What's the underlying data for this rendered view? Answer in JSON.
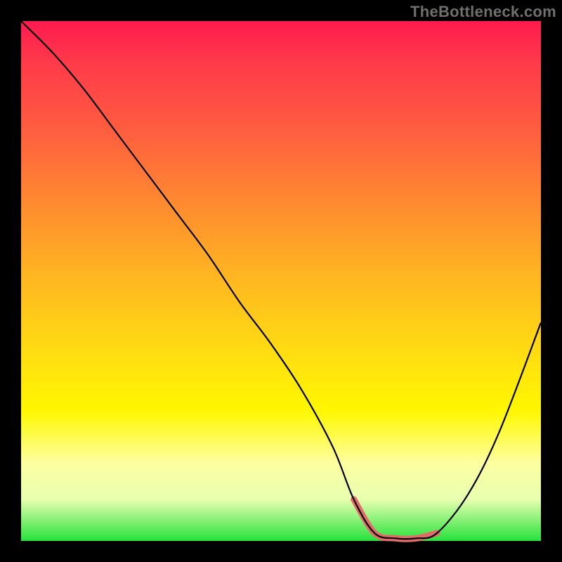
{
  "attribution": "TheBottleneck.com",
  "colors": {
    "gradient_top": "#ff1a4f",
    "gradient_bottom": "#26e23c",
    "curve": "#000000",
    "valley_highlight": "#e56b6b",
    "frame": "#000000"
  },
  "chart_data": {
    "type": "line",
    "title": "",
    "xlabel": "",
    "ylabel": "",
    "xlim": [
      0,
      100
    ],
    "ylim": [
      0,
      100
    ],
    "grid": false,
    "legend": false,
    "note": "Bottleneck curve over a red→green gradient. Lower y (toward green) means less bottleneck. Valley around x≈65–78 is highlighted.",
    "series": [
      {
        "name": "bottleneck-curve",
        "x": [
          0,
          6,
          12,
          18,
          24,
          30,
          36,
          42,
          48,
          54,
          60,
          64,
          68,
          72,
          76,
          80,
          86,
          92,
          100
        ],
        "y": [
          100,
          94,
          87,
          79,
          71,
          63,
          55,
          46,
          38,
          29,
          18,
          8,
          1.5,
          0.5,
          0.5,
          1.5,
          9,
          21,
          42
        ]
      }
    ],
    "highlight_range_x": [
      63,
      80
    ]
  }
}
